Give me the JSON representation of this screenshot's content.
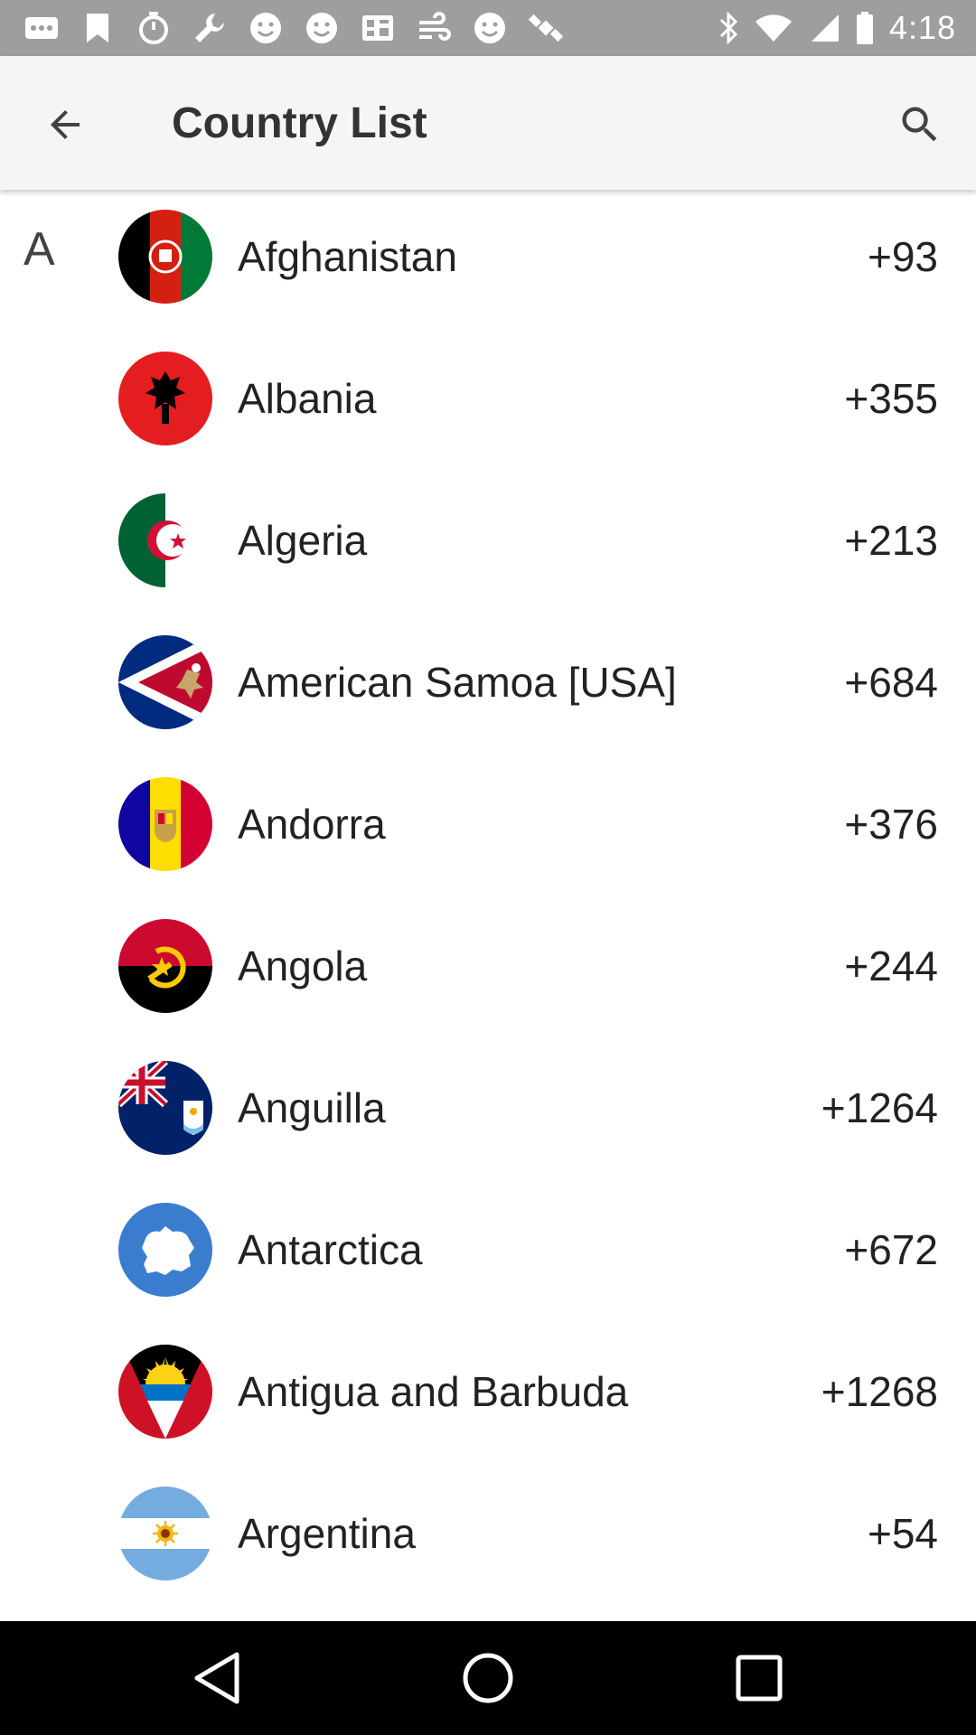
{
  "status_bar": {
    "time": "4:18",
    "notification_icons": [
      "more-icon",
      "bookmark-icon",
      "timer-icon",
      "wrench-icon",
      "smiley-icon",
      "smiley-icon",
      "qr-icon",
      "wind-icon",
      "smiley-icon",
      "satellite-icon"
    ],
    "system_icons": [
      "bluetooth-icon",
      "wifi-icon",
      "signal-icon",
      "battery-icon"
    ]
  },
  "app_bar": {
    "title": "Country List",
    "back_icon": "back-arrow-icon",
    "search_icon": "search-icon"
  },
  "section": {
    "letter": "A"
  },
  "countries": [
    {
      "name": "Afghanistan",
      "code": "+93",
      "flag": "afghanistan-flag-icon"
    },
    {
      "name": "Albania",
      "code": "+355",
      "flag": "albania-flag-icon"
    },
    {
      "name": "Algeria",
      "code": "+213",
      "flag": "algeria-flag-icon"
    },
    {
      "name": "American Samoa [USA]",
      "code": "+684",
      "flag": "american-samoa-flag-icon"
    },
    {
      "name": "Andorra",
      "code": "+376",
      "flag": "andorra-flag-icon"
    },
    {
      "name": "Angola",
      "code": "+244",
      "flag": "angola-flag-icon"
    },
    {
      "name": "Anguilla",
      "code": "+1264",
      "flag": "anguilla-flag-icon"
    },
    {
      "name": "Antarctica",
      "code": "+672",
      "flag": "antarctica-flag-icon"
    },
    {
      "name": "Antigua and Barbuda",
      "code": "+1268",
      "flag": "antigua-flag-icon"
    },
    {
      "name": "Argentina",
      "code": "+54",
      "flag": "argentina-flag-icon"
    }
  ],
  "nav_bar": {
    "back": "nav-back-icon",
    "home": "nav-home-icon",
    "recents": "nav-recents-icon"
  },
  "colors": {
    "status_bar": "#9e9e9e",
    "app_bar": "#f5f5f5",
    "nav_bar": "#000000"
  }
}
